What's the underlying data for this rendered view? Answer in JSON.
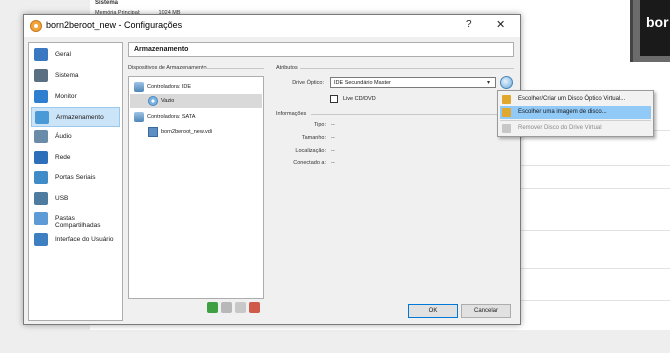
{
  "background": {
    "vm_section": "Sistema",
    "memory_label": "Memória Principal:",
    "memory_value": "1024 MB",
    "preview_text": "bor"
  },
  "dialog": {
    "title": "born2beroot_new - Configurações",
    "help_label": "?",
    "close_label": "✕",
    "page_title": "Armazenamento",
    "sidebar": [
      {
        "label": "Geral",
        "icon": "general-icon",
        "color": "#3a78c2"
      },
      {
        "label": "Sistema",
        "icon": "system-icon",
        "color": "#5b6f82"
      },
      {
        "label": "Monitor",
        "icon": "monitor-icon",
        "color": "#2f7fd1"
      },
      {
        "label": "Armazenamento",
        "icon": "storage-icon",
        "color": "#4a9ad8"
      },
      {
        "label": "Áudio",
        "icon": "audio-icon",
        "color": "#6b8ca8"
      },
      {
        "label": "Rede",
        "icon": "network-icon",
        "color": "#2d6fb8"
      },
      {
        "label": "Portas Seriais",
        "icon": "serial-ports-icon",
        "color": "#3f8cc9"
      },
      {
        "label": "USB",
        "icon": "usb-icon",
        "color": "#4d7ca0"
      },
      {
        "label": "Pastas Compartilhadas",
        "icon": "shared-folders-icon",
        "color": "#5d9ad6"
      },
      {
        "label": "Interface do Usuário",
        "icon": "user-interface-icon",
        "color": "#3d7fc0"
      }
    ],
    "storage_devices_label": "Dispositivos de Armazenamento",
    "tree": {
      "ide_controller": "Controladora: IDE",
      "ide_disc": "Vazio",
      "sata_controller": "Controladora: SATA",
      "sata_disk": "born2beroot_new.vdi"
    },
    "attributes_label": "Atributos",
    "optical_drive_label": "Drive Óptico:",
    "optical_drive_value": "IDE Secundário Master",
    "live_cd_label": "Live CD/DVD",
    "info_label": "Informações",
    "info": [
      {
        "label": "Tipo:",
        "value": "--"
      },
      {
        "label": "Tamanho:",
        "value": "--"
      },
      {
        "label": "Localização:",
        "value": "--"
      },
      {
        "label": "Conectado a:",
        "value": "--"
      }
    ],
    "ok_label": "OK",
    "cancel_label": "Cancelar"
  },
  "popup": {
    "items": [
      {
        "label": "Escolher/Criar um Disco Óptico Virtual...",
        "icon": "create-disc-icon",
        "highlighted": false,
        "disabled": false
      },
      {
        "label": "Escolher uma imagem de disco...",
        "icon": "choose-disk-image-icon",
        "highlighted": true,
        "disabled": false
      },
      {
        "label": "Remover Disco do Drive Virtual",
        "icon": "remove-disc-icon",
        "highlighted": false,
        "disabled": true
      }
    ]
  }
}
